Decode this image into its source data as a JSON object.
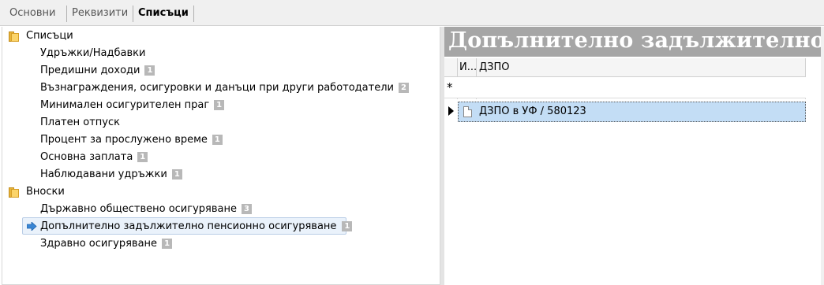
{
  "tabs": [
    {
      "label": "Основни"
    },
    {
      "label": "Реквизити"
    },
    {
      "label": "Списъци"
    }
  ],
  "tree": {
    "groups": [
      {
        "label": "Списъци",
        "items": [
          {
            "label": "Удръжки/Надбавки",
            "count": ""
          },
          {
            "label": "Предишни доходи",
            "count": "1"
          },
          {
            "label": "Възнаграждения, осигуровки и данъци при други работодатели",
            "count": "2"
          },
          {
            "label": "Минимален осигурителен праг",
            "count": "1"
          },
          {
            "label": "Платен отпуск",
            "count": ""
          },
          {
            "label": "Процент за прослужено време",
            "count": "1"
          },
          {
            "label": "Основна заплата",
            "count": "1"
          },
          {
            "label": "Наблюдавани удръжки",
            "count": "1"
          }
        ]
      },
      {
        "label": "Вноски",
        "items": [
          {
            "label": "Държавно обществено осигуряване",
            "count": "3"
          },
          {
            "label": "Допълнително задължително пенсионно осигуряване",
            "count": "1"
          },
          {
            "label": "Здравно осигуряване",
            "count": "1"
          }
        ]
      }
    ]
  },
  "detail": {
    "title": "Допълнително задължително пенсионно осигуряване",
    "columns": [
      "И...",
      "ДЗПО"
    ],
    "new_row_marker": "*",
    "rows": [
      {
        "label": "ДЗПО в УФ / 580123"
      }
    ]
  },
  "colors": {
    "title_band": "#a6a6a6",
    "selected_row": "#c3ddf5",
    "badge": "#b8b8b8"
  }
}
